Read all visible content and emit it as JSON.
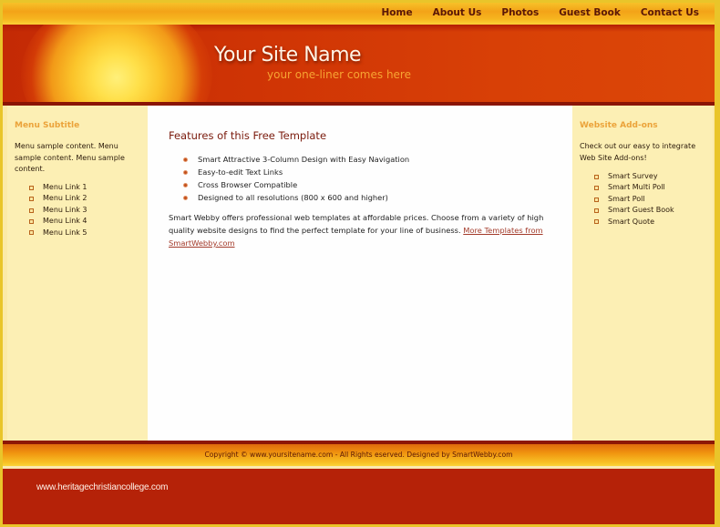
{
  "nav": {
    "items": [
      {
        "label": "Home"
      },
      {
        "label": "About Us"
      },
      {
        "label": "Photos"
      },
      {
        "label": "Guest Book"
      },
      {
        "label": "Contact Us"
      }
    ]
  },
  "header": {
    "site_name": "Your Site Name",
    "tagline": "your one-liner comes here"
  },
  "left_sidebar": {
    "title": "Menu Subtitle",
    "text": "Menu sample content. Menu sample content. Menu sample content.",
    "links": [
      {
        "label": "Menu Link 1"
      },
      {
        "label": "Menu Link 2"
      },
      {
        "label": "Menu Link 3"
      },
      {
        "label": "Menu Link 4"
      },
      {
        "label": "Menu Link 5"
      }
    ]
  },
  "main": {
    "title": "Features of this Free Template",
    "features": [
      "Smart Attractive 3-Column Design with Easy Navigation",
      "Easy-to-edit Text Links",
      "Cross Browser Compatible",
      "Designed to all resolutions (800 x 600 and higher)"
    ],
    "paragraph": "Smart Webby offers professional web templates at affordable prices. Choose from a variety of high quality website designs to find the perfect template for your line of business. ",
    "link_label": "More Templates from SmartWebby.com"
  },
  "right_sidebar": {
    "title": "Website Add-ons",
    "text": "Check out our easy to integrate Web Site Add-ons!",
    "links": [
      {
        "label": "Smart Survey"
      },
      {
        "label": "Smart Multi Poll"
      },
      {
        "label": "Smart Poll"
      },
      {
        "label": "Smart Guest Book"
      },
      {
        "label": "Smart Quote"
      }
    ]
  },
  "footer": {
    "copyright": "Copyright © www.yoursitename.com - All Rights eserved. Designed by SmartWebby.com",
    "watermark": "www.heritagechristiancollege.com"
  },
  "colors": {
    "accent_orange": "#eba33a",
    "header_red": "#cf3405",
    "footer_red": "#b52208",
    "sidebar_bg": "#fcefb4",
    "title_maroon": "#7a1a0c",
    "link_red": "#a33a2a"
  }
}
